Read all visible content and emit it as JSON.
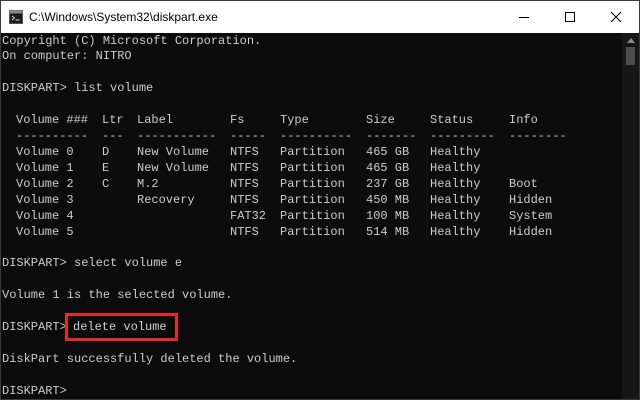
{
  "window": {
    "title": "C:\\Windows\\System32\\diskpart.exe"
  },
  "console": {
    "copyright": "Copyright (C) Microsoft Corporation.",
    "computer": "On computer: NITRO",
    "cmd1": "DISKPART> list volume",
    "headers": [
      "Volume ###",
      "Ltr",
      "Label",
      "Fs",
      "Type",
      "Size",
      "Status",
      "Info"
    ],
    "separators": [
      "----------",
      "---",
      "-----------",
      "-----",
      "----------",
      "-------",
      "---------",
      "--------"
    ],
    "rows": [
      [
        "Volume 0",
        "D",
        "New Volume",
        "NTFS",
        "Partition",
        "465 GB",
        "Healthy",
        ""
      ],
      [
        "Volume 1",
        "E",
        "New Volume",
        "NTFS",
        "Partition",
        "465 GB",
        "Healthy",
        ""
      ],
      [
        "Volume 2",
        "C",
        "M.2",
        "NTFS",
        "Partition",
        "237 GB",
        "Healthy",
        "Boot"
      ],
      [
        "Volume 3",
        "",
        "Recovery",
        "NTFS",
        "Partition",
        "450 MB",
        "Healthy",
        "Hidden"
      ],
      [
        "Volume 4",
        "",
        "",
        "FAT32",
        "Partition",
        "100 MB",
        "Healthy",
        "System"
      ],
      [
        "Volume 5",
        "",
        "",
        "NTFS",
        "Partition",
        "514 MB",
        "Healthy",
        "Hidden"
      ]
    ],
    "cmd2": "DISKPART> select volume e",
    "resp2": "Volume 1 is the selected volume.",
    "prompt3": "DISKPART>",
    "cmd3": "delete volume",
    "resp3": "DiskPart successfully deleted the volume.",
    "prompt4": "DISKPART>"
  },
  "colors": {
    "background": "#0c0c0c",
    "text": "#cccccc",
    "highlight_box": "#e02b2b"
  }
}
